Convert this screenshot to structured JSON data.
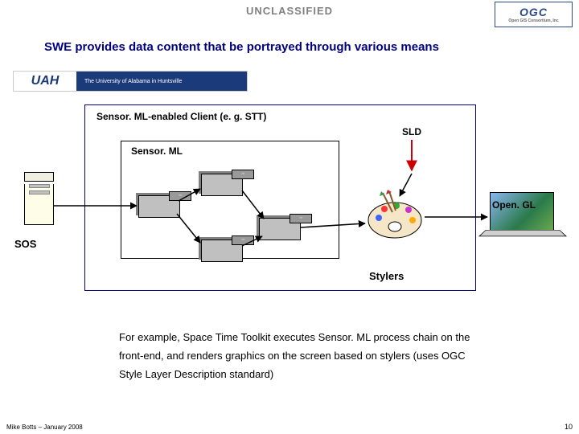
{
  "classification": "UNCLASSIFIED",
  "logo": {
    "ogc": "OGC",
    "ogc_sub": "Open GIS Consortium, Inc"
  },
  "title": "SWE provides data content that be portrayed through various means",
  "uah": {
    "logo": "UAH",
    "text": "The University of Alabama in Huntsville"
  },
  "client_box_label": "Sensor. ML-enabled Client (e. g. STT)",
  "sensorml_label": "Sensor. ML",
  "sld_label": "SLD",
  "sos_label": "SOS",
  "opengl_label": "Open. GL",
  "stylers_label": "Stylers",
  "paragraph": "For example, Space Time Toolkit executes Sensor. ML process chain on the front-end, and renders graphics on the screen based on stylers (uses OGC Style Layer Description standard)",
  "footer": {
    "left": "Mike Botts – January 2008",
    "right": "10"
  },
  "chart_data": {
    "type": "diagram",
    "title": "SWE provides data content that be portrayed through various means",
    "nodes": [
      {
        "id": "sos",
        "label": "SOS",
        "kind": "server"
      },
      {
        "id": "client",
        "label": "Sensor. ML-enabled Client (e. g. STT)",
        "kind": "container"
      },
      {
        "id": "sensorml",
        "label": "Sensor. ML",
        "kind": "container",
        "parent": "client"
      },
      {
        "id": "p1",
        "label": "",
        "kind": "process",
        "parent": "sensorml"
      },
      {
        "id": "p2",
        "label": "",
        "kind": "process",
        "parent": "sensorml"
      },
      {
        "id": "p3",
        "label": "",
        "kind": "process",
        "parent": "sensorml"
      },
      {
        "id": "p4",
        "label": "",
        "kind": "process",
        "parent": "sensorml"
      },
      {
        "id": "stylers",
        "label": "Stylers",
        "kind": "palette",
        "parent": "client"
      },
      {
        "id": "sld",
        "label": "SLD",
        "kind": "input",
        "parent": "client"
      },
      {
        "id": "laptop",
        "label": "Open. GL",
        "kind": "display"
      }
    ],
    "edges": [
      {
        "from": "sos",
        "to": "p1"
      },
      {
        "from": "p1",
        "to": "p2"
      },
      {
        "from": "p2",
        "to": "p3"
      },
      {
        "from": "p1",
        "to": "p4"
      },
      {
        "from": "p4",
        "to": "p3"
      },
      {
        "from": "p3",
        "to": "stylers"
      },
      {
        "from": "sld",
        "to": "stylers"
      },
      {
        "from": "stylers",
        "to": "laptop",
        "label": "Open. GL"
      }
    ],
    "annotations": [
      "For example, Space Time Toolkit executes Sensor. ML process chain on the front-end, and renders graphics on the screen based on stylers (uses OGC Style Layer Description standard)"
    ]
  }
}
